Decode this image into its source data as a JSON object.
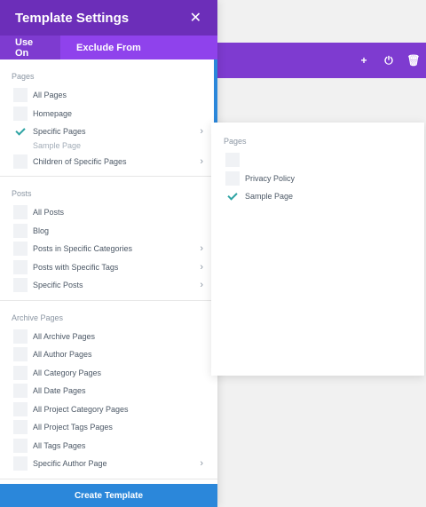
{
  "background_toolbar": {
    "icons": [
      "+",
      "⏻",
      "🗑"
    ]
  },
  "modal": {
    "title": "Template Settings",
    "close_symbol": "✕",
    "tabs": [
      {
        "label": "Use On"
      },
      {
        "label": "Exclude From"
      }
    ]
  },
  "sections": [
    {
      "title": "Pages",
      "items": [
        {
          "label": "All Pages",
          "checked": false
        },
        {
          "label": "Homepage",
          "checked": false
        },
        {
          "label": "Specific Pages",
          "checked": true,
          "chevron": true,
          "sub": "Sample Page"
        },
        {
          "label": "Children of Specific Pages",
          "checked": false,
          "chevron": true
        }
      ]
    },
    {
      "title": "Posts",
      "items": [
        {
          "label": "All Posts",
          "checked": false
        },
        {
          "label": "Blog",
          "checked": false
        },
        {
          "label": "Posts in Specific Categories",
          "checked": false,
          "chevron": true
        },
        {
          "label": "Posts with Specific Tags",
          "checked": false,
          "chevron": true
        },
        {
          "label": "Specific Posts",
          "checked": false,
          "chevron": true
        }
      ]
    },
    {
      "title": "Archive Pages",
      "items": [
        {
          "label": "All Archive Pages",
          "checked": false
        },
        {
          "label": "All Author Pages",
          "checked": false
        },
        {
          "label": "All Category Pages",
          "checked": false
        },
        {
          "label": "All Date Pages",
          "checked": false
        },
        {
          "label": "All Project Category Pages",
          "checked": false
        },
        {
          "label": "All Project Tags Pages",
          "checked": false
        },
        {
          "label": "All Tags Pages",
          "checked": false
        },
        {
          "label": "Specific Author Page",
          "checked": false,
          "chevron": true
        }
      ]
    }
  ],
  "footer": {
    "label": "Create Template"
  },
  "flyout": {
    "title": "Pages",
    "items": [
      {
        "label": "",
        "checked": false
      },
      {
        "label": "Privacy Policy",
        "checked": false
      },
      {
        "label": "Sample Page",
        "checked": true
      }
    ]
  },
  "colors": {
    "header": "#6c2eb9",
    "tabs": "#8f42ec",
    "active_tab": "#7e3bd0",
    "footer": "#2b87da",
    "check": "#2ea3a3"
  }
}
